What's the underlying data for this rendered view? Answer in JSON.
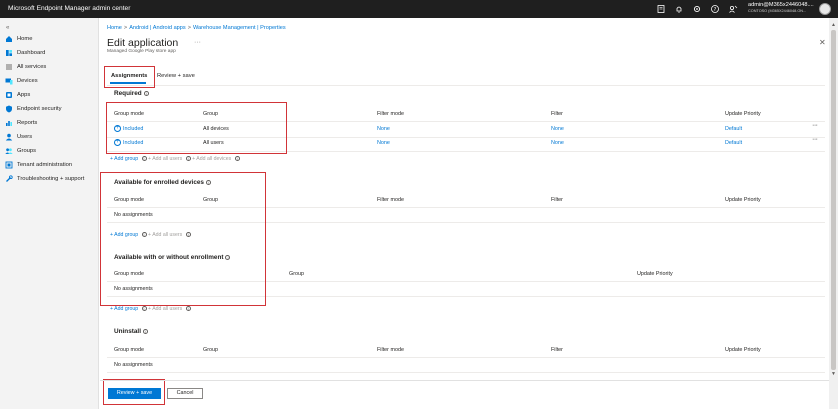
{
  "app_title": "Microsoft Endpoint Manager admin center",
  "user": {
    "name": "admin@M365x2446048....",
    "tenant": "CONTOSO (M365X2446048.ON..."
  },
  "sidebar": {
    "items": [
      {
        "label": "Home",
        "icon": "home-icon"
      },
      {
        "label": "Dashboard",
        "icon": "dashboard-icon"
      },
      {
        "label": "All services",
        "icon": "all-services-icon"
      },
      {
        "label": "Devices",
        "icon": "devices-icon"
      },
      {
        "label": "Apps",
        "icon": "apps-icon"
      },
      {
        "label": "Endpoint security",
        "icon": "shield-icon"
      },
      {
        "label": "Reports",
        "icon": "reports-icon"
      },
      {
        "label": "Users",
        "icon": "users-icon"
      },
      {
        "label": "Groups",
        "icon": "groups-icon"
      },
      {
        "label": "Tenant administration",
        "icon": "tenant-icon"
      },
      {
        "label": "Troubleshooting + support",
        "icon": "wrench-icon"
      }
    ]
  },
  "breadcrumb": [
    "Home",
    "Android | Android apps",
    "Warehouse Management | Properties"
  ],
  "page": {
    "title": "Edit application",
    "subtitle": "Managed Google Play store app",
    "more": "···"
  },
  "tabs": [
    "Assignments",
    "Review + save"
  ],
  "sections": {
    "required": {
      "title": "Required",
      "columns": [
        "Group mode",
        "Group",
        "Filter mode",
        "Filter",
        "Update Priority"
      ],
      "rows": [
        {
          "mode": "Included",
          "group": "All devices",
          "filter_mode": "None",
          "filter": "None",
          "priority": "Default"
        },
        {
          "mode": "Included",
          "group": "All users",
          "filter_mode": "None",
          "filter": "None",
          "priority": "Default"
        }
      ],
      "add_group": "+ Add group",
      "add_all_users": "+ Add all users",
      "add_all_devices": "+ Add all devices"
    },
    "available_enrolled": {
      "title": "Available for enrolled devices",
      "columns": [
        "Group mode",
        "Group",
        "Filter mode",
        "Filter",
        "Update Priority"
      ],
      "empty": "No assignments",
      "add_group": "+ Add group",
      "add_all_users": "+ Add all users"
    },
    "available_without": {
      "title": "Available with or without enrollment",
      "columns": [
        "Group mode",
        "Group",
        "Update Priority"
      ],
      "empty": "No assignments",
      "add_group": "+ Add group",
      "add_all_users": "+ Add all users"
    },
    "uninstall": {
      "title": "Uninstall",
      "columns": [
        "Group mode",
        "Group",
        "Filter mode",
        "Filter",
        "Update Priority"
      ],
      "empty": "No assignments"
    }
  },
  "footer": {
    "primary": "Review + save",
    "cancel": "Cancel"
  },
  "colors": {
    "accent": "#0078d4",
    "highlight": "#d13438",
    "topbar": "#1f1f1f"
  }
}
